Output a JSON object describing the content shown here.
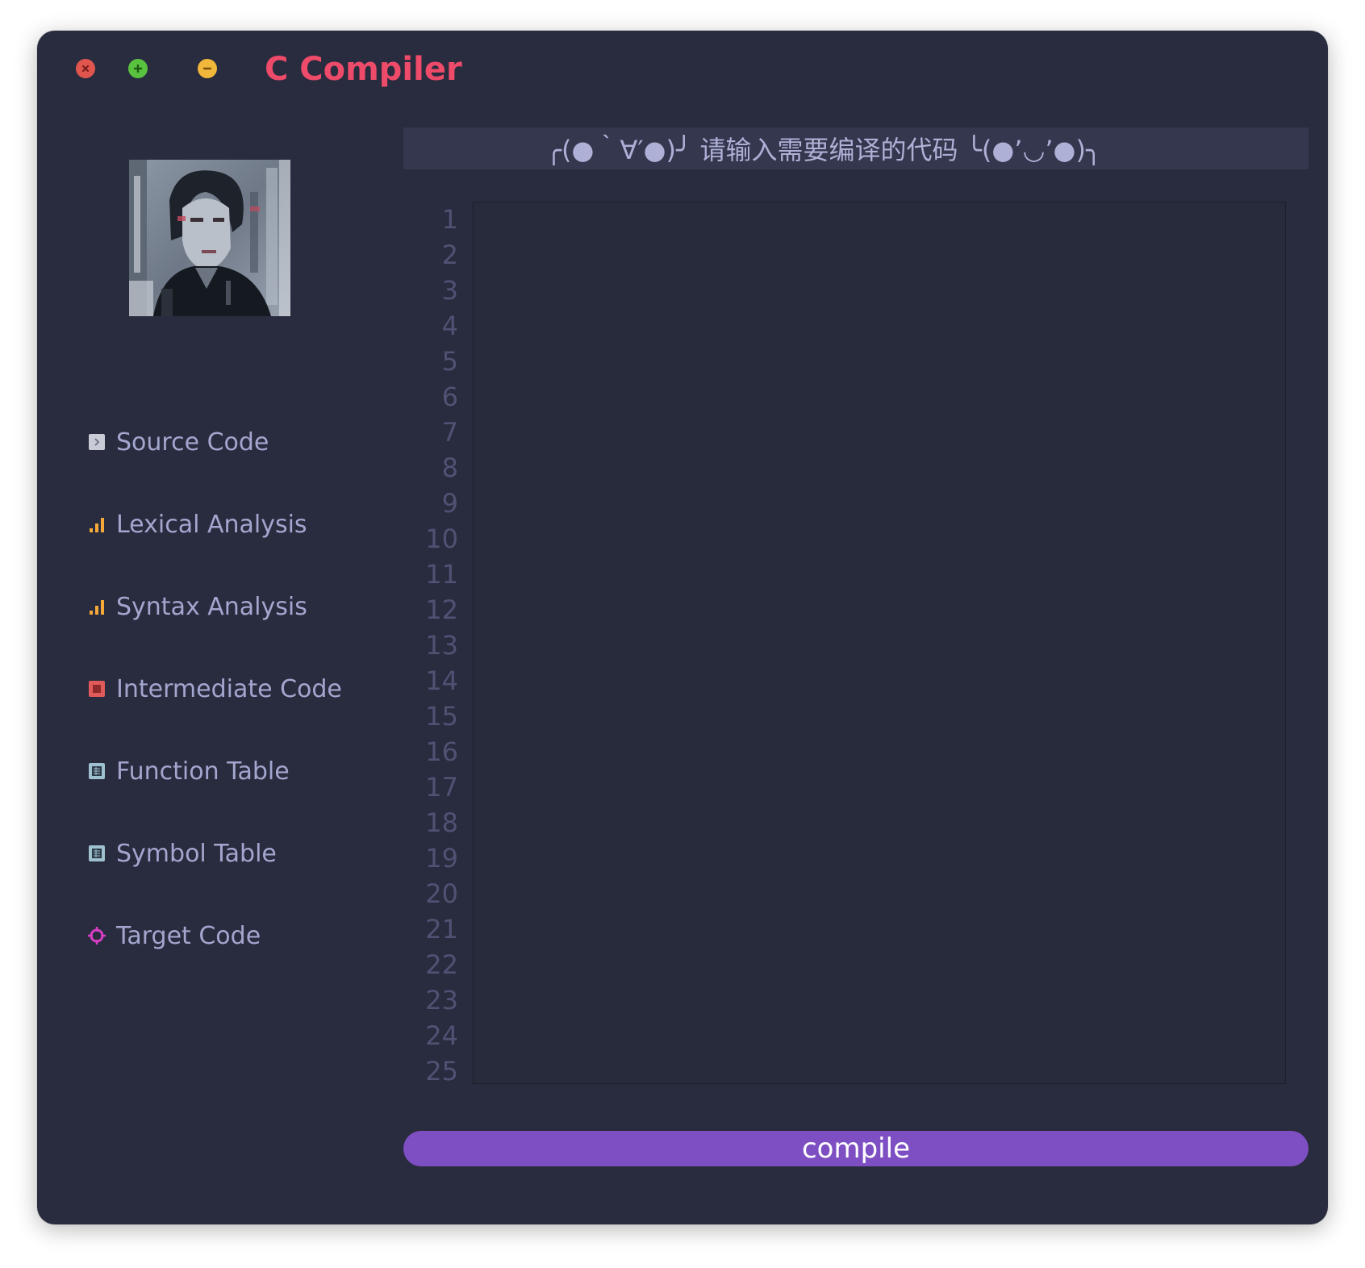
{
  "window": {
    "title": "C Compiler",
    "controls": [
      "close",
      "maximize",
      "minimize"
    ]
  },
  "sidebar": {
    "items": [
      {
        "label": "Source Code",
        "icon": "code-file-icon"
      },
      {
        "label": "Lexical Analysis",
        "icon": "bar-chart-icon"
      },
      {
        "label": "Syntax Analysis",
        "icon": "bar-chart-icon"
      },
      {
        "label": "Intermediate Code",
        "icon": "red-square-icon"
      },
      {
        "label": "Function Table",
        "icon": "table-icon"
      },
      {
        "label": "Symbol Table",
        "icon": "table-icon"
      },
      {
        "label": "Target Code",
        "icon": "target-icon"
      }
    ]
  },
  "editor": {
    "banner": "╭(●｀∀′●)╯  请输入需要编译的代码  ╰(●’◡’●)╮",
    "content": "",
    "line_numbers": [
      "1",
      "2",
      "3",
      "4",
      "5",
      "6",
      "7",
      "8",
      "9",
      "10",
      "11",
      "12",
      "13",
      "14",
      "15",
      "16",
      "17",
      "18",
      "19",
      "20",
      "21",
      "22",
      "23",
      "24",
      "25"
    ]
  },
  "compile_button": {
    "label": "compile"
  },
  "colors": {
    "window_bg": "#292c3e",
    "title": "#ee4a6a",
    "nav_text": "#a3a6ce",
    "banner_bg": "#34374d",
    "line_number": "#4f5273",
    "button_bg": "#7e4fc3"
  }
}
